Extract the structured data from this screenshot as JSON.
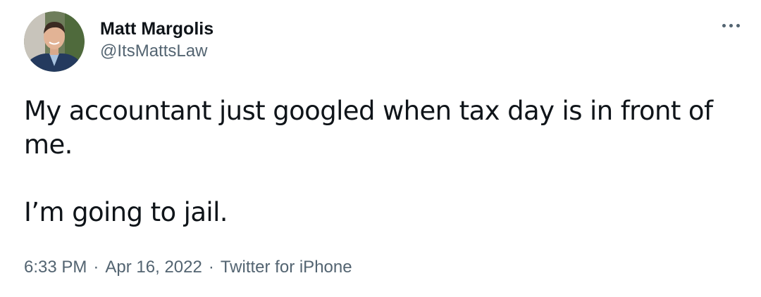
{
  "author": {
    "display_name": "Matt Margolis",
    "handle": "@ItsMattsLaw"
  },
  "tweet": {
    "line1": "My accountant just googled when tax day is in front of me.",
    "line2": "I’m going to jail."
  },
  "meta": {
    "time": "6:33 PM",
    "separator": "·",
    "date": "Apr 16, 2022",
    "source": "Twitter for iPhone"
  },
  "icons": {
    "more": "more-horizontal-icon",
    "avatar": "profile-photo"
  },
  "colors": {
    "text_primary": "#0f1419",
    "text_secondary": "#536471",
    "background": "#ffffff"
  }
}
